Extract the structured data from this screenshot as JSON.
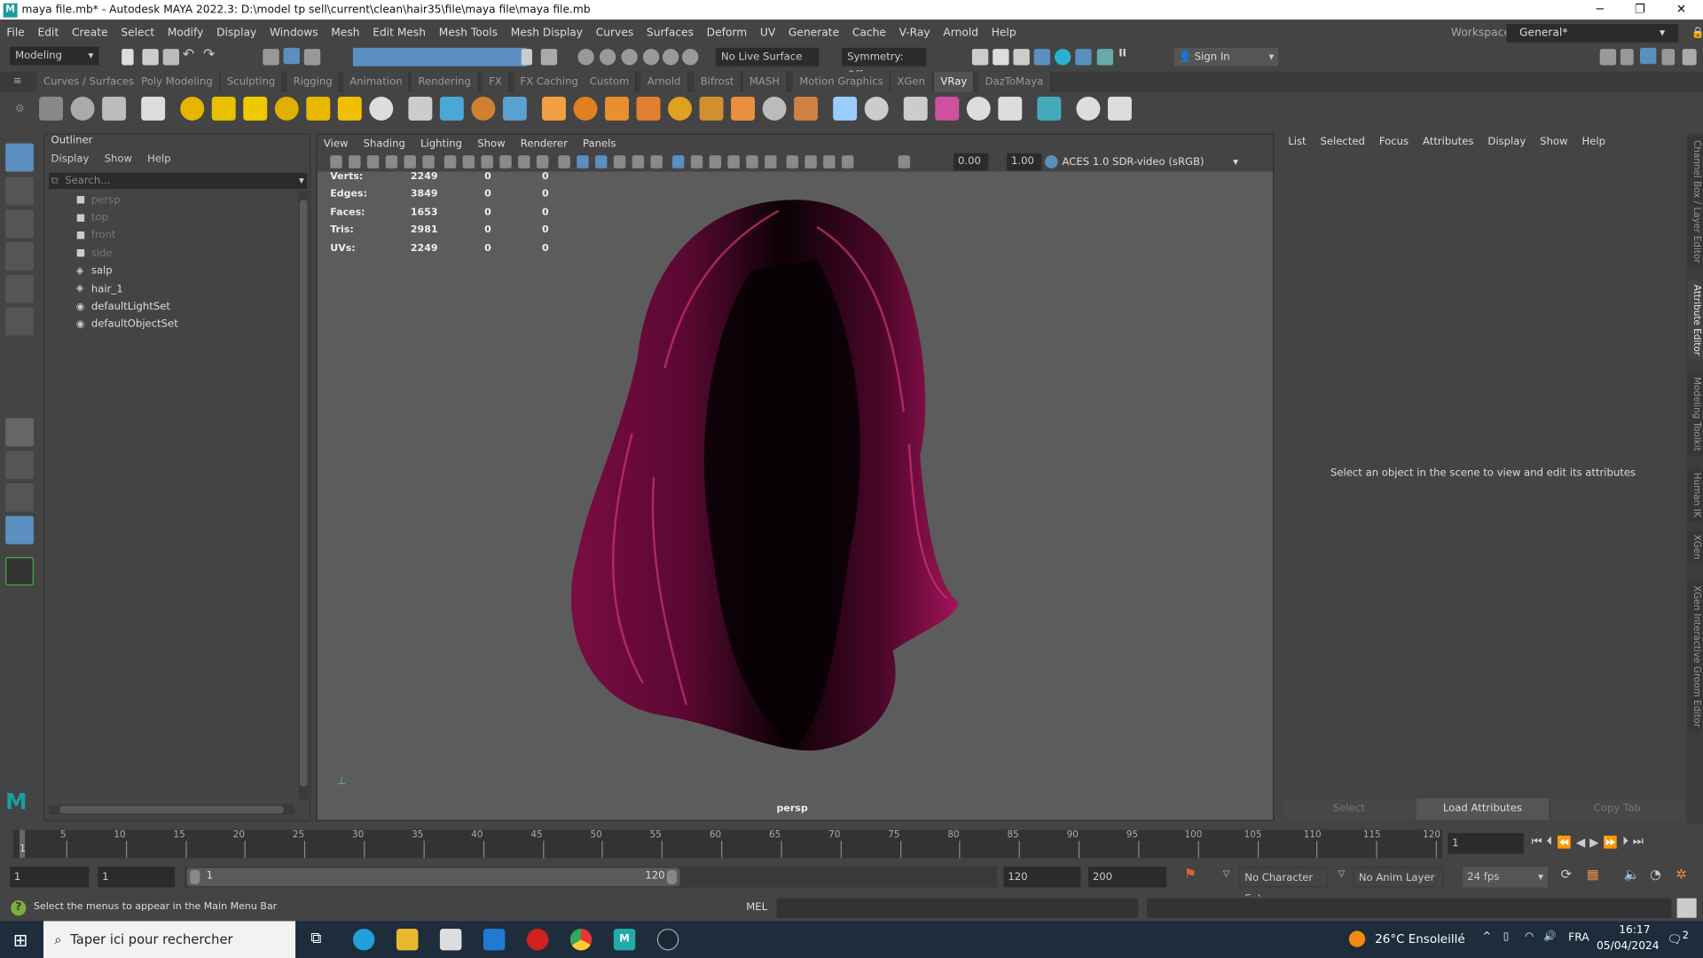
{
  "window": {
    "title": "maya file.mb* - Autodesk MAYA 2022.3: D:\\model tp sell\\current\\clean\\hair35\\file\\maya file\\maya file.mb",
    "logo": "M",
    "minimize": "─",
    "maximize": "❐",
    "close": "✕"
  },
  "menubar": {
    "items": [
      "File",
      "Edit",
      "Create",
      "Select",
      "Modify",
      "Display",
      "Windows",
      "Mesh",
      "Edit Mesh",
      "Mesh Tools",
      "Mesh Display",
      "Curves",
      "Surfaces",
      "Deform",
      "UV",
      "Generate",
      "Cache",
      "V-Ray",
      "Arnold",
      "Help"
    ],
    "workspace_label": "Workspace:",
    "workspace_value": "General*"
  },
  "statusline": {
    "mode": "Modeling",
    "live_surface": "No Live Surface",
    "symmetry": "Symmetry: Off",
    "sign_in": "Sign In"
  },
  "shelf": {
    "tabs": [
      "Curves / Surfaces",
      "Poly Modeling",
      "Sculpting",
      "Rigging",
      "Animation",
      "Rendering",
      "FX",
      "FX Caching",
      "Custom",
      "Arnold",
      "Bifrost",
      "MASH",
      "Motion Graphics",
      "XGen",
      "VRay",
      "DazToMaya"
    ],
    "active": "VRay",
    "icons": [
      [
        "vray-scene-icon",
        "#888"
      ],
      [
        "vray-sphere-icon",
        "#aaa"
      ],
      [
        "vray-camera-icon",
        "#bbb"
      ],
      [
        "vray-frame-buffer-icon",
        "#ddd"
      ],
      [
        "vray-dome-light-icon",
        "#e8b400"
      ],
      [
        "vray-spot-light-icon",
        "#e8c000"
      ],
      [
        "vray-sphere-light-icon",
        "#f0c800"
      ],
      [
        "vray-mesh-light-icon",
        "#e0b000"
      ],
      [
        "vray-ies-light-icon",
        "#e8b800"
      ],
      [
        "vray-sun-icon",
        "#f0c000"
      ],
      [
        "vray-plane-icon",
        "#ddd"
      ],
      [
        "vray-proxy-icon",
        "#ccc"
      ],
      [
        "vray-fur-icon",
        "#4aa8d8"
      ],
      [
        "vray-displacement-icon",
        "#d08030"
      ],
      [
        "vray-scene-access-icon",
        "#5aa0d0"
      ],
      [
        "vray-material-icon",
        "#f0a040"
      ],
      [
        "vray-clipper-icon",
        "#e08020"
      ],
      [
        "vray-fur2-icon",
        "#e89030"
      ],
      [
        "vray-decal-icon",
        "#e08030"
      ],
      [
        "vray-grid-icon",
        "#e0a020"
      ],
      [
        "vray-volume-icon",
        "#d09030"
      ],
      [
        "vray-toon-icon",
        "#e89040"
      ],
      [
        "vray-probe-icon",
        "#bbb"
      ],
      [
        "vray-settings-icon",
        "#d08040"
      ],
      [
        "vray-object-props-icon",
        "#9cf"
      ],
      [
        "vray-light-select-icon",
        "#ccc"
      ],
      [
        "vray-sampler-icon",
        "#ccc"
      ],
      [
        "vray-mtl-icon",
        "#d050a0"
      ],
      [
        "vray-multi-icon",
        "#ddd"
      ],
      [
        "vray-paint-icon",
        "#ddd"
      ],
      [
        "vray-vfb-icon",
        "#4ab"
      ],
      [
        "vray-ipr-icon",
        "#ddd"
      ],
      [
        "vray-logo-icon",
        "#ddd"
      ]
    ]
  },
  "outliner": {
    "title": "Outliner",
    "menu": [
      "Display",
      "Show",
      "Help"
    ],
    "search_placeholder": "Search...",
    "items": [
      {
        "label": "persp",
        "type": "camera",
        "dim": true
      },
      {
        "label": "top",
        "type": "camera",
        "dim": true
      },
      {
        "label": "front",
        "type": "camera",
        "dim": true
      },
      {
        "label": "side",
        "type": "camera",
        "dim": true
      },
      {
        "label": "salp",
        "type": "mesh",
        "dim": false
      },
      {
        "label": "hair_1",
        "type": "mesh",
        "dim": false
      },
      {
        "label": "defaultLightSet",
        "type": "set",
        "dim": false
      },
      {
        "label": "defaultObjectSet",
        "type": "set",
        "dim": false
      }
    ]
  },
  "viewport": {
    "menu": [
      "View",
      "Shading",
      "Lighting",
      "Show",
      "Renderer",
      "Panels"
    ],
    "exposure": "0.00",
    "gamma": "1.00",
    "color_space": "ACES 1.0 SDR-video (sRGB)",
    "camera": "persp",
    "stats": [
      {
        "label": "Verts:",
        "a": "2249",
        "b": "0",
        "c": "0"
      },
      {
        "label": "Edges:",
        "a": "3849",
        "b": "0",
        "c": "0"
      },
      {
        "label": "Faces:",
        "a": "1653",
        "b": "0",
        "c": "0"
      },
      {
        "label": "Tris:",
        "a": "2981",
        "b": "0",
        "c": "0"
      },
      {
        "label": "UVs:",
        "a": "2249",
        "b": "0",
        "c": "0"
      }
    ],
    "hair_color": "#8a1048"
  },
  "attribute_editor": {
    "menu": [
      "List",
      "Selected",
      "Focus",
      "Attributes",
      "Display",
      "Show",
      "Help"
    ],
    "message": "Select an object in the scene to view and edit its attributes",
    "select": "Select",
    "load": "Load Attributes",
    "copy_tab": "Copy Tab"
  },
  "side_tabs": [
    "Channel Box / Layer Editor",
    "Attribute Editor",
    "Modeling Toolkit",
    "Human IK",
    "XGen",
    "XGen Interactive Groom Editor"
  ],
  "timeline": {
    "ticks": [
      "5",
      "10",
      "15",
      "20",
      "25",
      "30",
      "35",
      "40",
      "45",
      "50",
      "55",
      "60",
      "65",
      "70",
      "75",
      "80",
      "85",
      "90",
      "95",
      "100",
      "105",
      "110",
      "115",
      "120"
    ],
    "current": "1",
    "current_field": "1"
  },
  "range": {
    "start": "1",
    "anim_start": "1",
    "range_start": "1",
    "range_end": "120",
    "end": "120",
    "anim_end": "200",
    "character_set": "No Character Set",
    "anim_layer": "No Anim Layer",
    "fps": "24 fps"
  },
  "cmdline": {
    "help": "Select the menus to appear in the Main Menu Bar",
    "lang": "MEL"
  },
  "taskbar": {
    "search": "Taper ici pour rechercher",
    "weather": "26°C  Ensoleillé",
    "lang": "FRA",
    "time": "16:17",
    "date": "05/04/2024",
    "notifications": "2"
  }
}
